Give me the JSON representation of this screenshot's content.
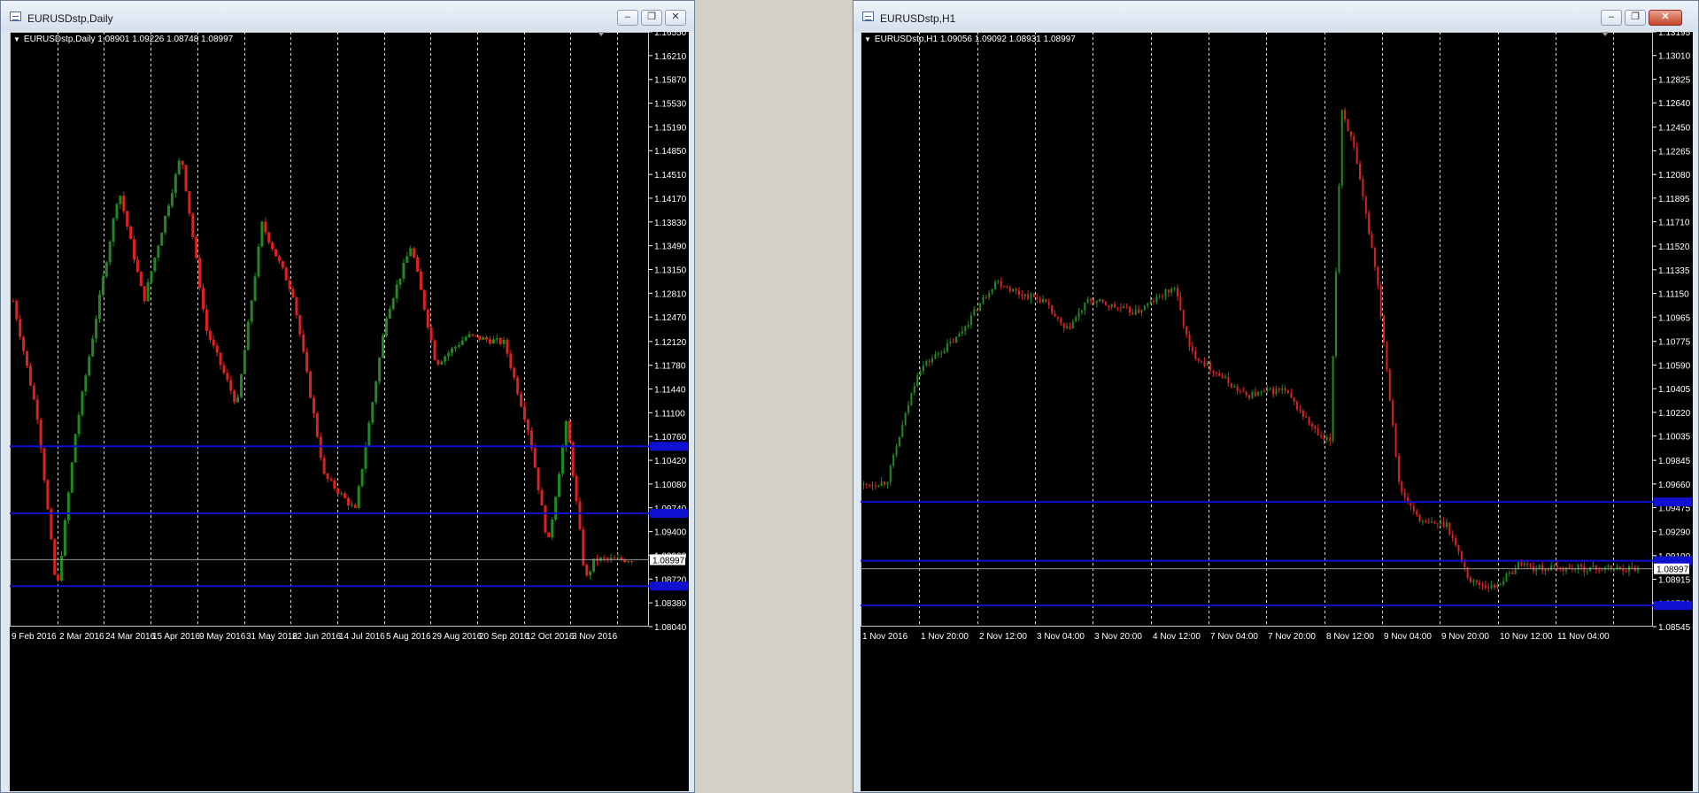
{
  "windows": [
    {
      "title": "EURUSDstp,Daily",
      "symbol_line": "EURUSDstp,Daily  1.08901 1.09226 1.08748 1.08997",
      "y_ticks": [
        1.1655,
        1.1621,
        1.1587,
        1.1553,
        1.1519,
        1.1485,
        1.1451,
        1.1417,
        1.1383,
        1.1349,
        1.1315,
        1.1281,
        1.1247,
        1.1212,
        1.1178,
        1.1144,
        1.111,
        1.1076,
        1.1042,
        1.1008,
        1.0974,
        1.094,
        1.0906,
        1.0872,
        1.0838,
        1.0804
      ],
      "y_tick_labels": [
        "1.16550",
        "1.16210",
        "1.15870",
        "1.15530",
        "1.15190",
        "1.14850",
        "1.14510",
        "1.14170",
        "1.13830",
        "1.13490",
        "1.13150",
        "1.12810",
        "1.12470",
        "1.12120",
        "1.11780",
        "1.11440",
        "1.11100",
        "1.10760",
        "1.10420",
        "1.10080",
        "1.09740",
        "1.09400",
        "1.09060",
        "1.08720",
        "1.08380",
        "1.08040"
      ],
      "x_tick_labels": [
        "9 Feb 2016",
        "2 Mar 2016",
        "24 Mar 2016",
        "15 Apr 2016",
        "9 May 2016",
        "31 May 2016",
        "22 Jun 2016",
        "14 Jul 2016",
        "5 Aug 2016",
        "29 Aug 2016",
        "20 Sep 2016",
        "12 Oct 2016",
        "3 Nov 2016"
      ],
      "horizontal_lines": [
        1.1062,
        1.0966,
        1.0862
      ],
      "current_price": 1.08997,
      "current_price_label": "1.08997"
    },
    {
      "title": "EURUSDstp,H1",
      "symbol_line": "EURUSDstp,H1  1.09056 1.09092 1.08931 1.08997",
      "y_ticks": [
        1.13195,
        1.1301,
        1.12825,
        1.1264,
        1.1245,
        1.12265,
        1.1208,
        1.11895,
        1.1171,
        1.1152,
        1.11335,
        1.1115,
        1.10965,
        1.10775,
        1.1059,
        1.10405,
        1.1022,
        1.10035,
        1.09845,
        1.0966,
        1.09475,
        1.0929,
        1.091,
        1.08915,
        1.0873,
        1.08545
      ],
      "y_tick_labels": [
        "1.13195",
        "1.13010",
        "1.12825",
        "1.12640",
        "1.12450",
        "1.12265",
        "1.12080",
        "1.11895",
        "1.11710",
        "1.11520",
        "1.11335",
        "1.11150",
        "1.10965",
        "1.10775",
        "1.10590",
        "1.10405",
        "1.10220",
        "1.10035",
        "1.09845",
        "1.09660",
        "1.09475",
        "1.09290",
        "1.09100",
        "1.08915",
        "1.08730",
        "1.08545"
      ],
      "x_tick_labels": [
        "1 Nov 2016",
        "1 Nov 20:00",
        "2 Nov 12:00",
        "3 Nov 04:00",
        "3 Nov 20:00",
        "4 Nov 12:00",
        "7 Nov 04:00",
        "7 Nov 20:00",
        "8 Nov 12:00",
        "9 Nov 04:00",
        "9 Nov 20:00",
        "10 Nov 12:00",
        "11 Nov 04:00"
      ],
      "horizontal_lines": [
        1.0952,
        1.0906,
        1.0871
      ],
      "current_price": 1.08997,
      "current_price_label": "1.08997"
    }
  ],
  "colors": {
    "background": "#000000",
    "bull_candle": "#1f8a1f",
    "bear_candle": "#e02020",
    "support_line": "#1010d0",
    "grid": "#ffffff"
  }
}
